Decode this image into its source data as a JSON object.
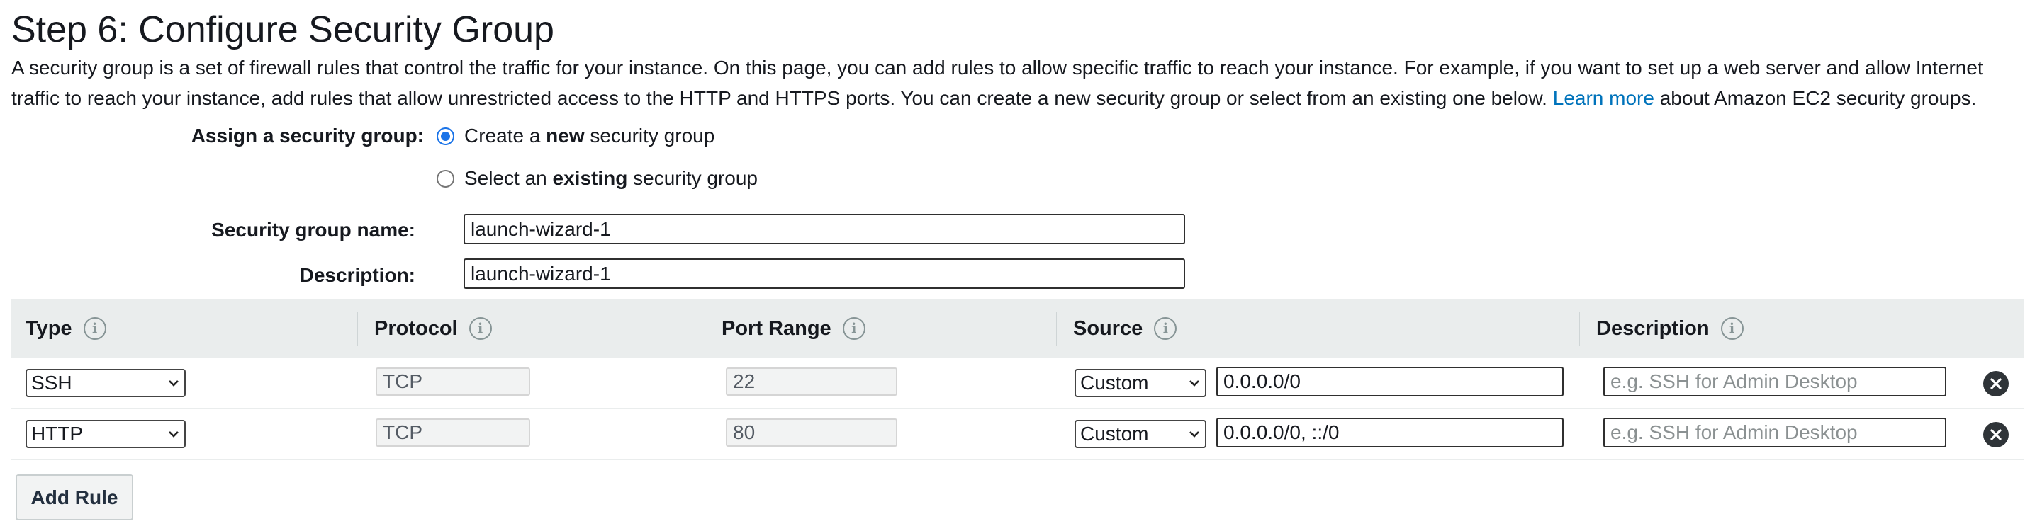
{
  "page": {
    "title": "Step 6: Configure Security Group",
    "intro_text": "A security group is a set of firewall rules that control the traffic for your instance. On this page, you can add rules to allow specific traffic to reach your instance. For example, if you want to set up a web server and allow Internet traffic to reach your instance, add rules that allow unrestricted access to the HTTP and HTTPS ports. You can create a new security group or select from an existing one below.",
    "learn_more_link": "Learn more",
    "intro_suffix": "about Amazon EC2 security groups."
  },
  "assign": {
    "label": "Assign a security group:",
    "options": [
      {
        "prefix": "Create a ",
        "bold": "new",
        "suffix": " security group",
        "selected": true
      },
      {
        "prefix": "Select an ",
        "bold": "existing",
        "suffix": " security group",
        "selected": false
      }
    ]
  },
  "form": {
    "name_label": "Security group name:",
    "name_value": "launch-wizard-1",
    "description_label": "Description:",
    "description_value": "launch-wizard-1"
  },
  "table": {
    "columns": [
      {
        "label": "Type",
        "icon": "info-icon"
      },
      {
        "label": "Protocol",
        "icon": "info-icon"
      },
      {
        "label": "Port Range",
        "icon": "info-icon"
      },
      {
        "label": "Source",
        "icon": "info-icon"
      },
      {
        "label": "Description",
        "icon": "info-icon"
      }
    ],
    "rows": [
      {
        "type": "SSH",
        "protocol": "TCP",
        "port_range": "22",
        "source_mode": "Custom",
        "source_value": "0.0.0.0/0",
        "description_placeholder": "e.g. SSH for Admin Desktop"
      },
      {
        "type": "HTTP",
        "protocol": "TCP",
        "port_range": "80",
        "source_mode": "Custom",
        "source_value": "0.0.0.0/0, ::/0",
        "description_placeholder": "e.g. SSH for Admin Desktop"
      }
    ]
  },
  "actions": {
    "add_rule_label": "Add Rule"
  },
  "colors": {
    "link": "#0073bb",
    "radio_selected": "#1a73e8",
    "table_header_bg": "#eaeded",
    "remove_button_bg": "#2f3438"
  }
}
